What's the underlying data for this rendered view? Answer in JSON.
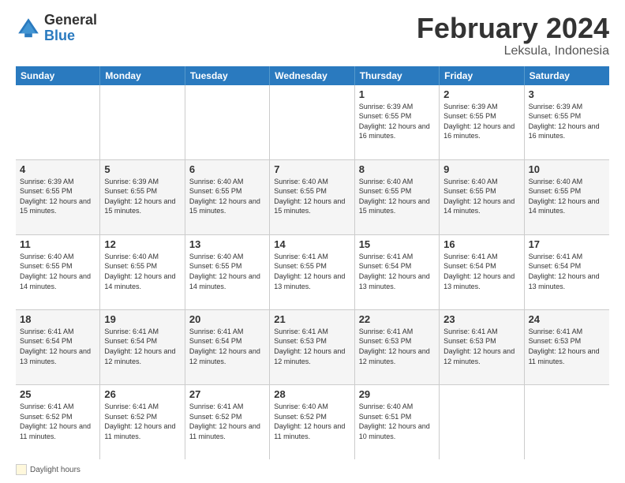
{
  "header": {
    "logo_general": "General",
    "logo_blue": "Blue",
    "title": "February 2024",
    "subtitle": "Leksula, Indonesia"
  },
  "days_of_week": [
    "Sunday",
    "Monday",
    "Tuesday",
    "Wednesday",
    "Thursday",
    "Friday",
    "Saturday"
  ],
  "rows": [
    [
      {
        "day": "",
        "info": "",
        "empty": true
      },
      {
        "day": "",
        "info": "",
        "empty": true
      },
      {
        "day": "",
        "info": "",
        "empty": true
      },
      {
        "day": "",
        "info": "",
        "empty": true
      },
      {
        "day": "1",
        "info": "Sunrise: 6:39 AM\nSunset: 6:55 PM\nDaylight: 12 hours and 16 minutes.",
        "empty": false
      },
      {
        "day": "2",
        "info": "Sunrise: 6:39 AM\nSunset: 6:55 PM\nDaylight: 12 hours and 16 minutes.",
        "empty": false
      },
      {
        "day": "3",
        "info": "Sunrise: 6:39 AM\nSunset: 6:55 PM\nDaylight: 12 hours and 16 minutes.",
        "empty": false
      }
    ],
    [
      {
        "day": "4",
        "info": "Sunrise: 6:39 AM\nSunset: 6:55 PM\nDaylight: 12 hours and 15 minutes.",
        "empty": false
      },
      {
        "day": "5",
        "info": "Sunrise: 6:39 AM\nSunset: 6:55 PM\nDaylight: 12 hours and 15 minutes.",
        "empty": false
      },
      {
        "day": "6",
        "info": "Sunrise: 6:40 AM\nSunset: 6:55 PM\nDaylight: 12 hours and 15 minutes.",
        "empty": false
      },
      {
        "day": "7",
        "info": "Sunrise: 6:40 AM\nSunset: 6:55 PM\nDaylight: 12 hours and 15 minutes.",
        "empty": false
      },
      {
        "day": "8",
        "info": "Sunrise: 6:40 AM\nSunset: 6:55 PM\nDaylight: 12 hours and 15 minutes.",
        "empty": false
      },
      {
        "day": "9",
        "info": "Sunrise: 6:40 AM\nSunset: 6:55 PM\nDaylight: 12 hours and 14 minutes.",
        "empty": false
      },
      {
        "day": "10",
        "info": "Sunrise: 6:40 AM\nSunset: 6:55 PM\nDaylight: 12 hours and 14 minutes.",
        "empty": false
      }
    ],
    [
      {
        "day": "11",
        "info": "Sunrise: 6:40 AM\nSunset: 6:55 PM\nDaylight: 12 hours and 14 minutes.",
        "empty": false
      },
      {
        "day": "12",
        "info": "Sunrise: 6:40 AM\nSunset: 6:55 PM\nDaylight: 12 hours and 14 minutes.",
        "empty": false
      },
      {
        "day": "13",
        "info": "Sunrise: 6:40 AM\nSunset: 6:55 PM\nDaylight: 12 hours and 14 minutes.",
        "empty": false
      },
      {
        "day": "14",
        "info": "Sunrise: 6:41 AM\nSunset: 6:55 PM\nDaylight: 12 hours and 13 minutes.",
        "empty": false
      },
      {
        "day": "15",
        "info": "Sunrise: 6:41 AM\nSunset: 6:54 PM\nDaylight: 12 hours and 13 minutes.",
        "empty": false
      },
      {
        "day": "16",
        "info": "Sunrise: 6:41 AM\nSunset: 6:54 PM\nDaylight: 12 hours and 13 minutes.",
        "empty": false
      },
      {
        "day": "17",
        "info": "Sunrise: 6:41 AM\nSunset: 6:54 PM\nDaylight: 12 hours and 13 minutes.",
        "empty": false
      }
    ],
    [
      {
        "day": "18",
        "info": "Sunrise: 6:41 AM\nSunset: 6:54 PM\nDaylight: 12 hours and 13 minutes.",
        "empty": false
      },
      {
        "day": "19",
        "info": "Sunrise: 6:41 AM\nSunset: 6:54 PM\nDaylight: 12 hours and 12 minutes.",
        "empty": false
      },
      {
        "day": "20",
        "info": "Sunrise: 6:41 AM\nSunset: 6:54 PM\nDaylight: 12 hours and 12 minutes.",
        "empty": false
      },
      {
        "day": "21",
        "info": "Sunrise: 6:41 AM\nSunset: 6:53 PM\nDaylight: 12 hours and 12 minutes.",
        "empty": false
      },
      {
        "day": "22",
        "info": "Sunrise: 6:41 AM\nSunset: 6:53 PM\nDaylight: 12 hours and 12 minutes.",
        "empty": false
      },
      {
        "day": "23",
        "info": "Sunrise: 6:41 AM\nSunset: 6:53 PM\nDaylight: 12 hours and 12 minutes.",
        "empty": false
      },
      {
        "day": "24",
        "info": "Sunrise: 6:41 AM\nSunset: 6:53 PM\nDaylight: 12 hours and 11 minutes.",
        "empty": false
      }
    ],
    [
      {
        "day": "25",
        "info": "Sunrise: 6:41 AM\nSunset: 6:52 PM\nDaylight: 12 hours and 11 minutes.",
        "empty": false
      },
      {
        "day": "26",
        "info": "Sunrise: 6:41 AM\nSunset: 6:52 PM\nDaylight: 12 hours and 11 minutes.",
        "empty": false
      },
      {
        "day": "27",
        "info": "Sunrise: 6:41 AM\nSunset: 6:52 PM\nDaylight: 12 hours and 11 minutes.",
        "empty": false
      },
      {
        "day": "28",
        "info": "Sunrise: 6:40 AM\nSunset: 6:52 PM\nDaylight: 12 hours and 11 minutes.",
        "empty": false
      },
      {
        "day": "29",
        "info": "Sunrise: 6:40 AM\nSunset: 6:51 PM\nDaylight: 12 hours and 10 minutes.",
        "empty": false
      },
      {
        "day": "",
        "info": "",
        "empty": true
      },
      {
        "day": "",
        "info": "",
        "empty": true
      }
    ]
  ],
  "footer": {
    "daylight_label": "Daylight hours"
  }
}
